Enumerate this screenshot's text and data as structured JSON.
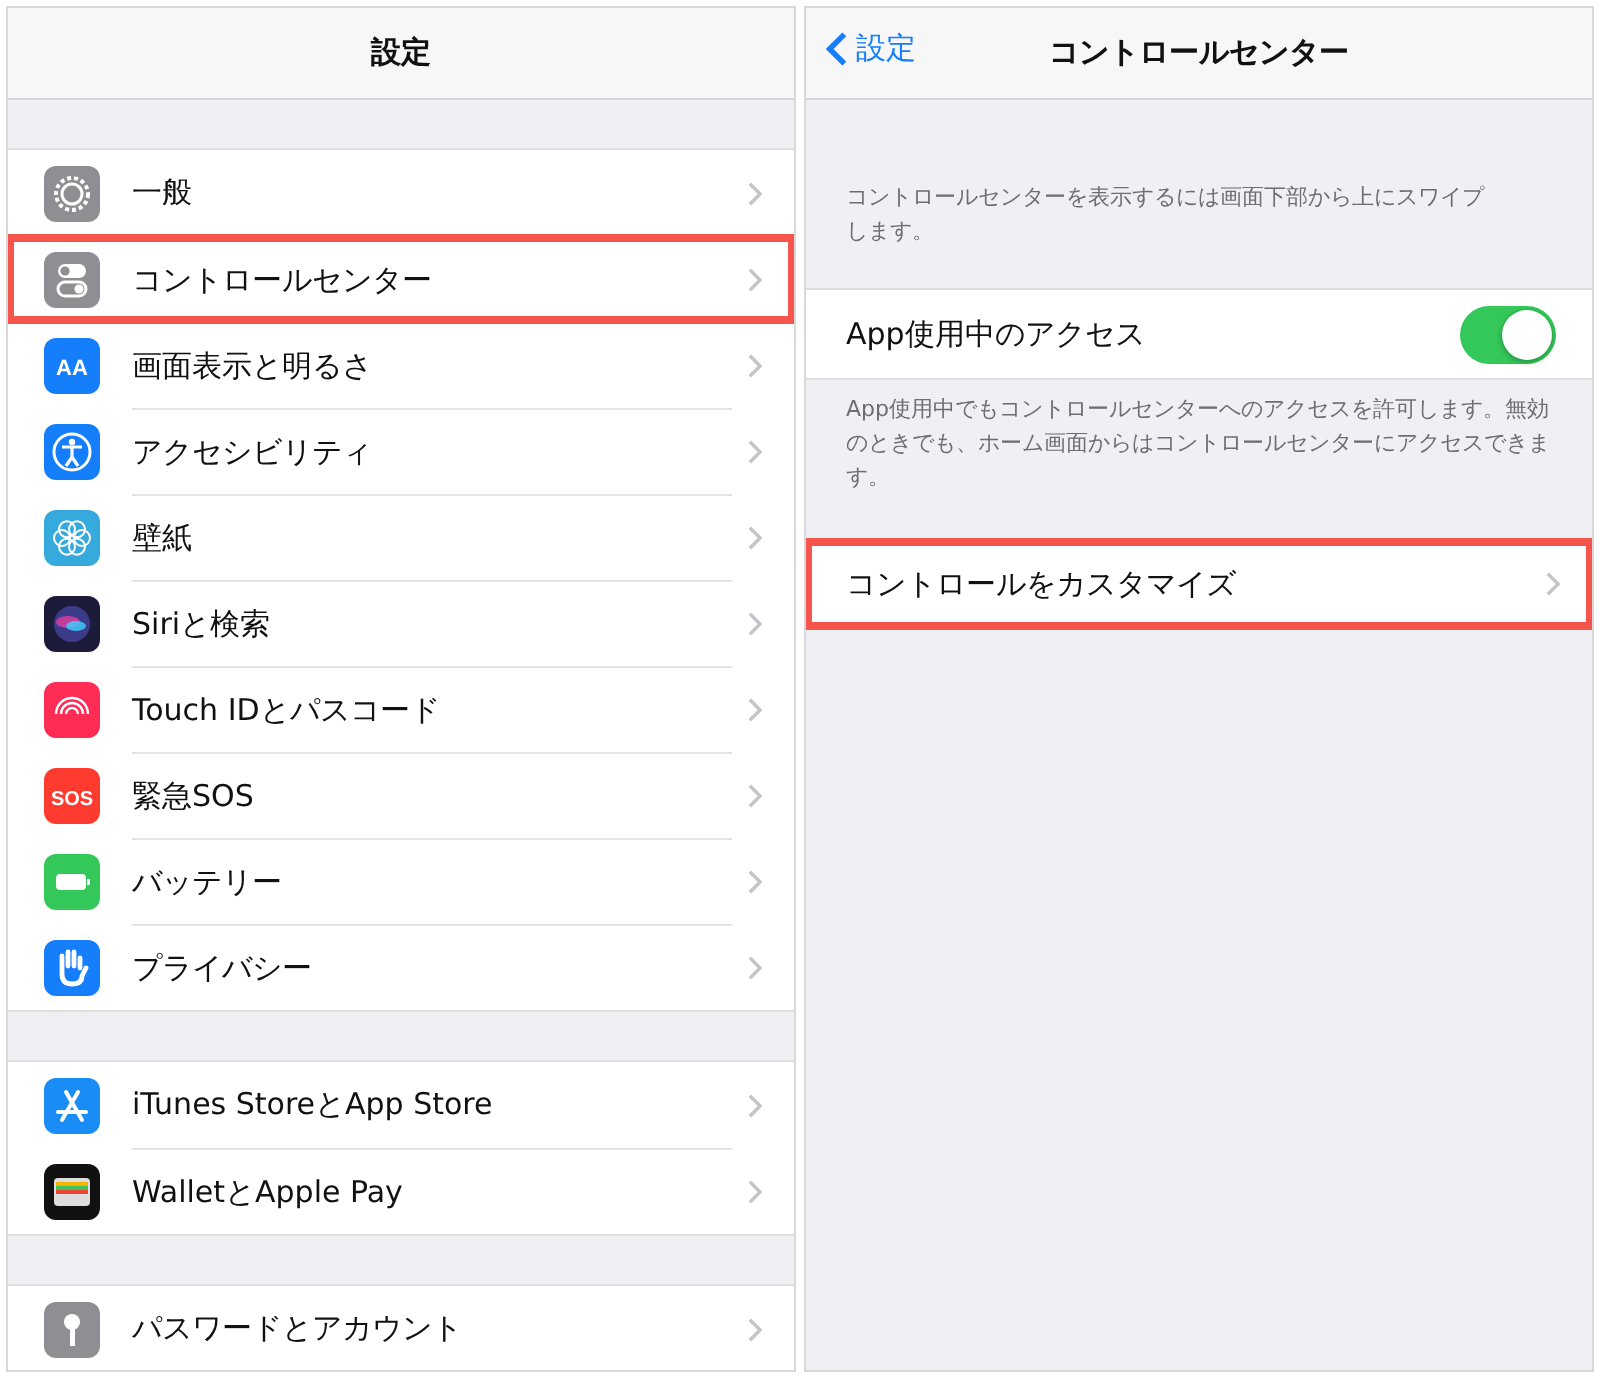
{
  "settings_panel": {
    "title": "設定",
    "groups": [
      {
        "items": [
          {
            "kind": "gear",
            "label": "一般",
            "highlighted": false
          },
          {
            "kind": "toggles",
            "label": "コントロールセンター",
            "highlighted": true
          },
          {
            "kind": "text-size",
            "icon_label": "AA",
            "label": "画面表示と明るさ",
            "highlighted": false
          },
          {
            "kind": "accessibility",
            "label": "アクセシビリティ",
            "highlighted": false
          },
          {
            "kind": "flower",
            "label": "壁紙",
            "highlighted": false
          },
          {
            "kind": "siri",
            "label": "Siriと検索",
            "highlighted": false
          },
          {
            "kind": "fingerprint",
            "label": "Touch IDとパスコード",
            "highlighted": false
          },
          {
            "kind": "sos",
            "icon_label": "SOS",
            "label": "緊急SOS",
            "highlighted": false
          },
          {
            "kind": "battery",
            "label": "バッテリー",
            "highlighted": false
          },
          {
            "kind": "hand",
            "label": "プライバシー",
            "highlighted": false
          }
        ]
      },
      {
        "items": [
          {
            "kind": "appstore",
            "label": "iTunes StoreとApp Store",
            "highlighted": false
          },
          {
            "kind": "wallet",
            "label": "WalletとApple Pay",
            "highlighted": false
          }
        ]
      },
      {
        "items": [
          {
            "kind": "key",
            "label": "パスワードとアカウント",
            "highlighted": false
          }
        ]
      }
    ]
  },
  "control_center_panel": {
    "back": "設定",
    "title": "コントロールセンター",
    "intro": "コントロールセンターを表示するには画面下部から上にスワイプします。",
    "access_row": {
      "label": "App使用中のアクセス",
      "on": true
    },
    "access_note": "App使用中でもコントロールセンターへのアクセスを許可します。無効のときでも、ホーム画面からはコントロールセンターにアクセスできます。",
    "customize_row": {
      "label": "コントロールをカスタマイズ",
      "highlighted": true
    }
  }
}
